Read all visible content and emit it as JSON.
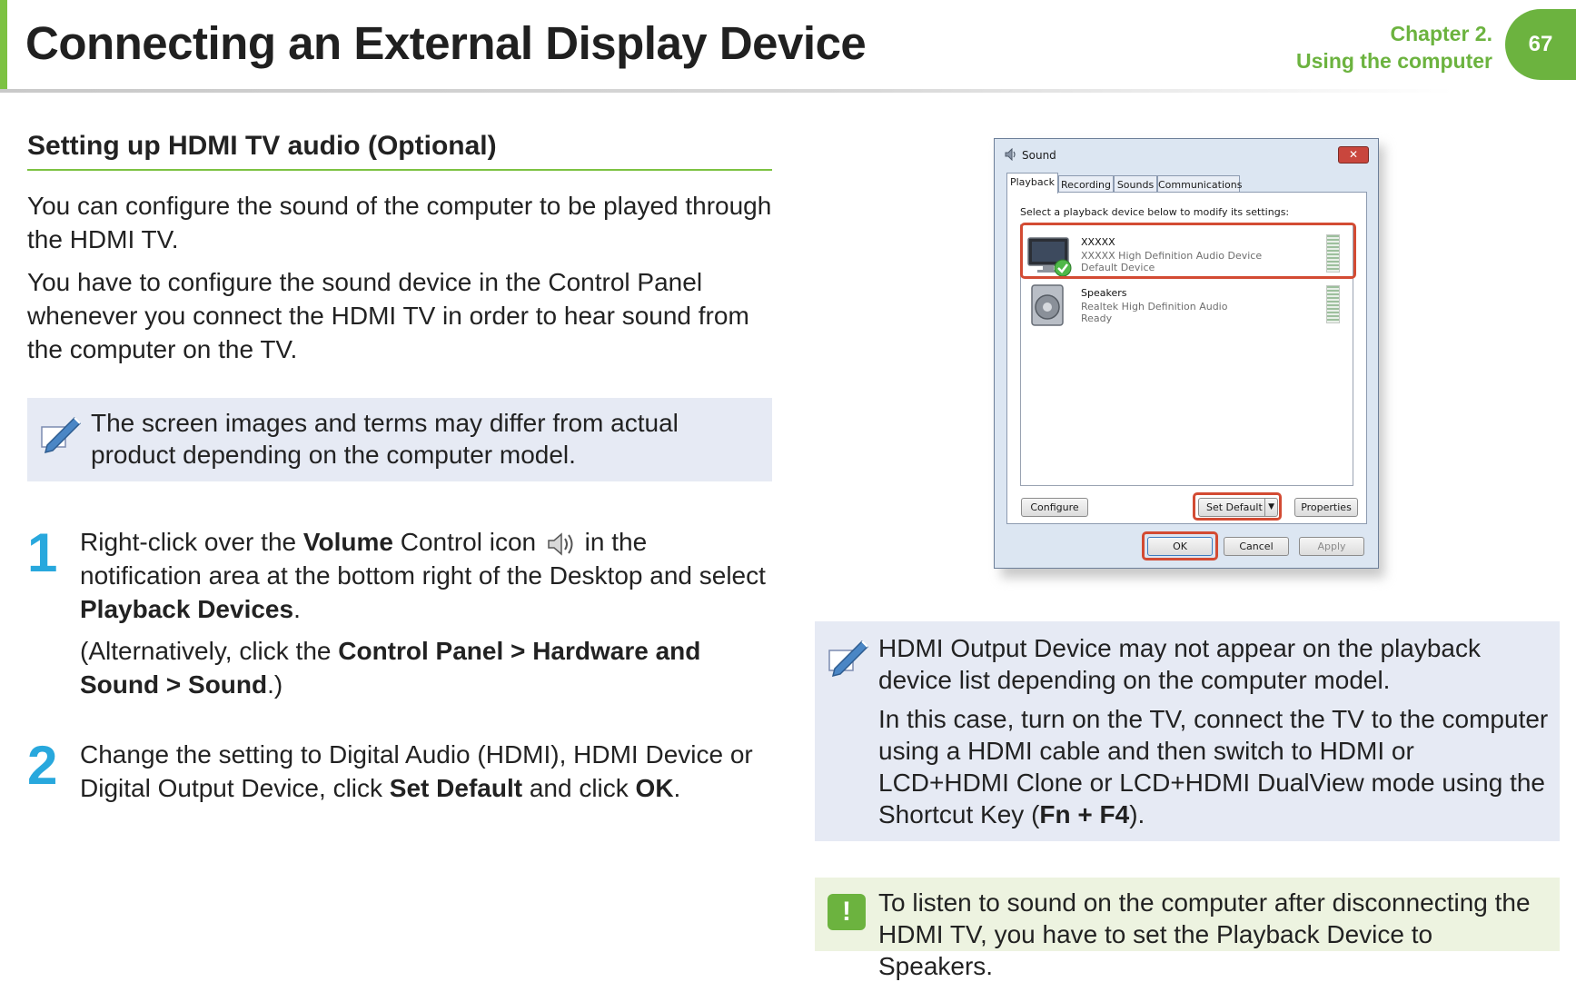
{
  "header": {
    "title": "Connecting an External Display Device",
    "chapter_line1": "Chapter 2.",
    "chapter_line2": "Using the computer",
    "page_number": "67"
  },
  "section": {
    "heading": "Setting up HDMI TV audio (Optional)",
    "para1": "You can configure the sound of the computer to be played through the HDMI TV.",
    "para2": "You have to configure the sound device in the Control Panel whenever you connect the HDMI TV in order to hear sound from the computer on the TV.",
    "note": "The screen images and terms may differ from actual product depending on the computer model."
  },
  "steps": [
    {
      "number": "1",
      "t1": "Right-click over the ",
      "b1": "Volume",
      "t2": " Control icon ",
      "t3": " in the notification area at the bottom right of the Desktop and select ",
      "b2": "Playback Devices",
      "t4": ".",
      "alt_open": "(Alternatively, click the ",
      "alt_b1": "Control Panel",
      "alt_sep1": " > ",
      "alt_b2": "Hardware and Sound",
      "alt_sep2": " > ",
      "alt_b3": "Sound",
      "alt_close": ".)"
    },
    {
      "number": "2",
      "t1": "Change the setting to Digital Audio (HDMI), HDMI Device or Digital Output Device, click ",
      "b1": "Set Default",
      "t2": " and click ",
      "b2": "OK",
      "t3": "."
    }
  ],
  "dialog": {
    "title": "Sound",
    "close_label": "✕",
    "tabs": [
      "Playback",
      "Recording",
      "Sounds",
      "Communications"
    ],
    "instruction": "Select a playback device below to modify its settings:",
    "devices": [
      {
        "name": "XXXXX",
        "description": "XXXXX High Definition Audio Device",
        "status": "Default Device",
        "icon": "monitor-icon",
        "is_default": true
      },
      {
        "name": "Speakers",
        "description": "Realtek High Definition Audio",
        "status": "Ready",
        "icon": "speaker-icon",
        "is_default": false
      }
    ],
    "buttons": {
      "configure": "Configure",
      "set_default": "Set Default",
      "properties": "Properties",
      "ok": "OK",
      "cancel": "Cancel",
      "apply": "Apply"
    },
    "highlight_color": "#d34b33"
  },
  "note_right": {
    "line1": "HDMI Output Device may not appear on the playback device list depending on the computer model.",
    "p2_text": "In this case, turn on the TV, connect the TV to the computer using a HDMI cable and then switch to HDMI or LCD+HDMI Clone or LCD+HDMI DualView mode using the Shortcut Key (",
    "p2_bold": "Fn + F4",
    "p2_end": ")."
  },
  "caution": {
    "icon": "!",
    "text": "To listen to sound on the computer after disconnecting the HDMI TV, you have to set the Playback Device to Speakers."
  },
  "colors": {
    "accent_green": "#6cb33f",
    "step_blue": "#28a8dd",
    "note_bg": "#e6eaf4",
    "caution_bg": "#edf3e0"
  }
}
